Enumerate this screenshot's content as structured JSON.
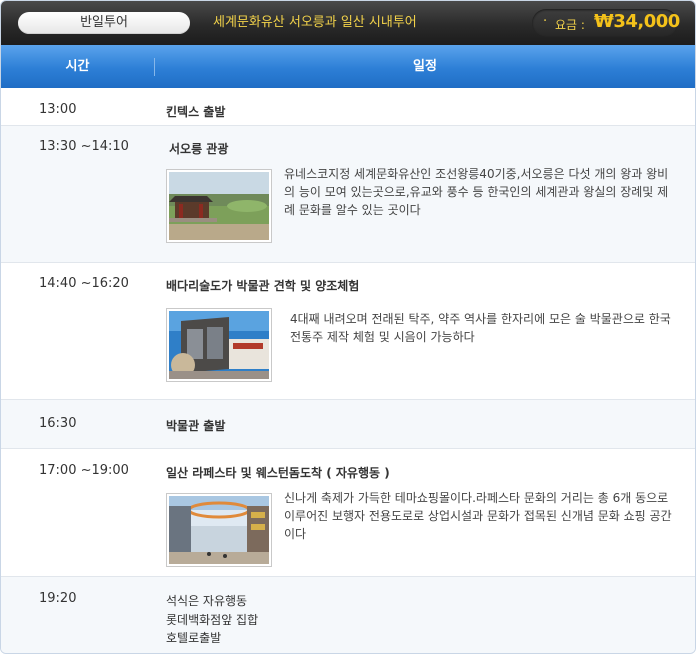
{
  "header": {
    "tab_label": "반일투어",
    "tour_title": "세계문화유산 서오릉과 일산 시내투어",
    "price_bullet": "·",
    "price_label": "요금 :",
    "price_value": "₩34,000"
  },
  "columns": {
    "time": "시간",
    "schedule": "일정"
  },
  "schedule": [
    {
      "time": "13:00",
      "title": "킨텍스 출발"
    },
    {
      "time": "13:30 ~14:10",
      "title": "서오릉 관광",
      "image": "royal-tomb-photo",
      "description": "유네스코지정 세계문화유산인 조선왕릉40기중,서오릉은 다섯 개의 왕과 왕비의 능이 모여 있는곳으로,유교와 풍수 등 한국인의 세계관과 왕실의 장례및 제례 문화를 알수 있는 곳이다"
    },
    {
      "time": "14:40 ~16:20",
      "title": "배다리술도가 박물관 견학 및 양조체험",
      "image": "liquor-museum-photo",
      "description": "4대째 내려오며 전래된 탁주, 약주 역사를 한자리에 모은 술 박물관으로 한국 전통주 제작 체험 및 시음이 가능하다"
    },
    {
      "time": "16:30",
      "title": "박물관 출발"
    },
    {
      "time": "17:00 ~19:00",
      "title": "일산  라페스타 및 웨스턴돔도착 ( 자유행동 )",
      "image": "shopping-street-photo",
      "description": "신나게 축제가 가득한 테마쇼핑몰이다.라페스타 문화의 거리는 총 6개 동으로 이루어진 보행자 전용도로로 상업시설과 문화가 접목된 신개념   문화 쇼핑 공간이다"
    },
    {
      "time": "19:20",
      "title": "석식은 자유행동",
      "lines": [
        "롯데백화점앞 집합",
        "호텔로출발"
      ]
    }
  ],
  "colors": {
    "topbar": "#2a2a2a",
    "accent_yellow": "#f2d24a",
    "header_blue": "#2d7fd6",
    "row_alt": "#f5f8fb"
  }
}
